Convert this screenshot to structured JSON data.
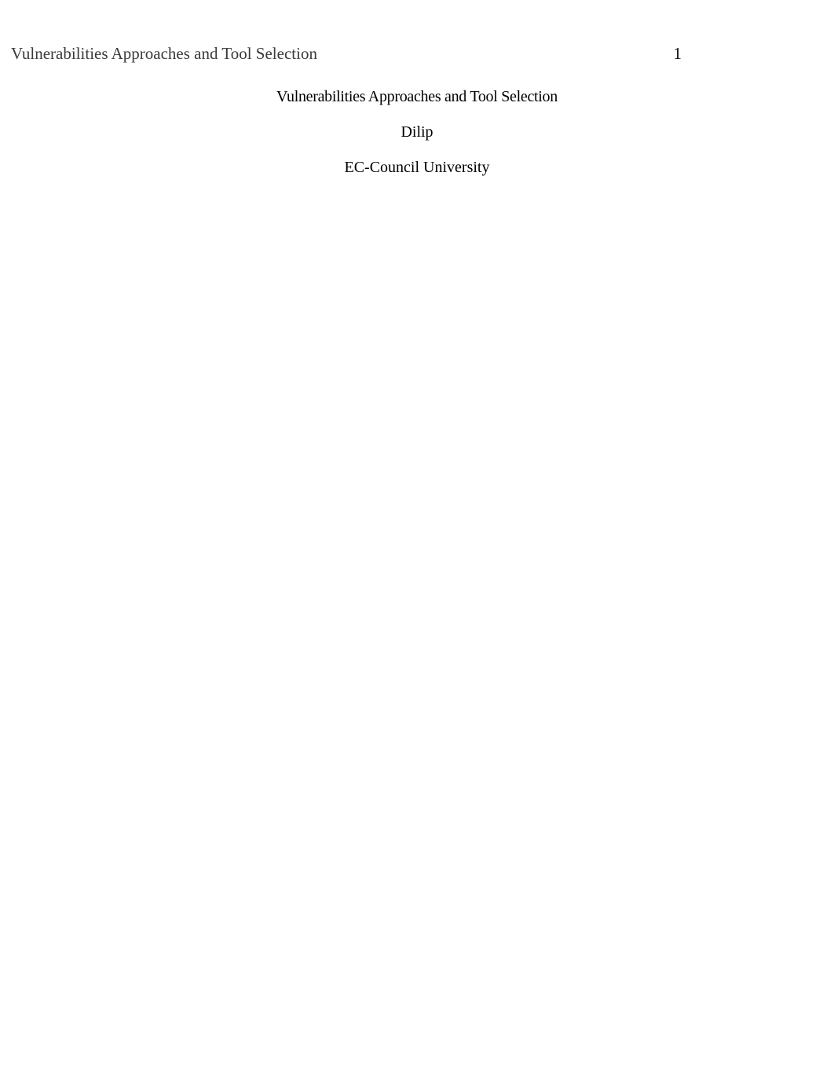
{
  "header": {
    "running_head": "Vulnerabilities Approaches and Tool Selection",
    "page_number": "1"
  },
  "content": {
    "title": "Vulnerabilities Approaches and Tool Selection",
    "author": "Dilip",
    "institution": "EC-Council University"
  }
}
